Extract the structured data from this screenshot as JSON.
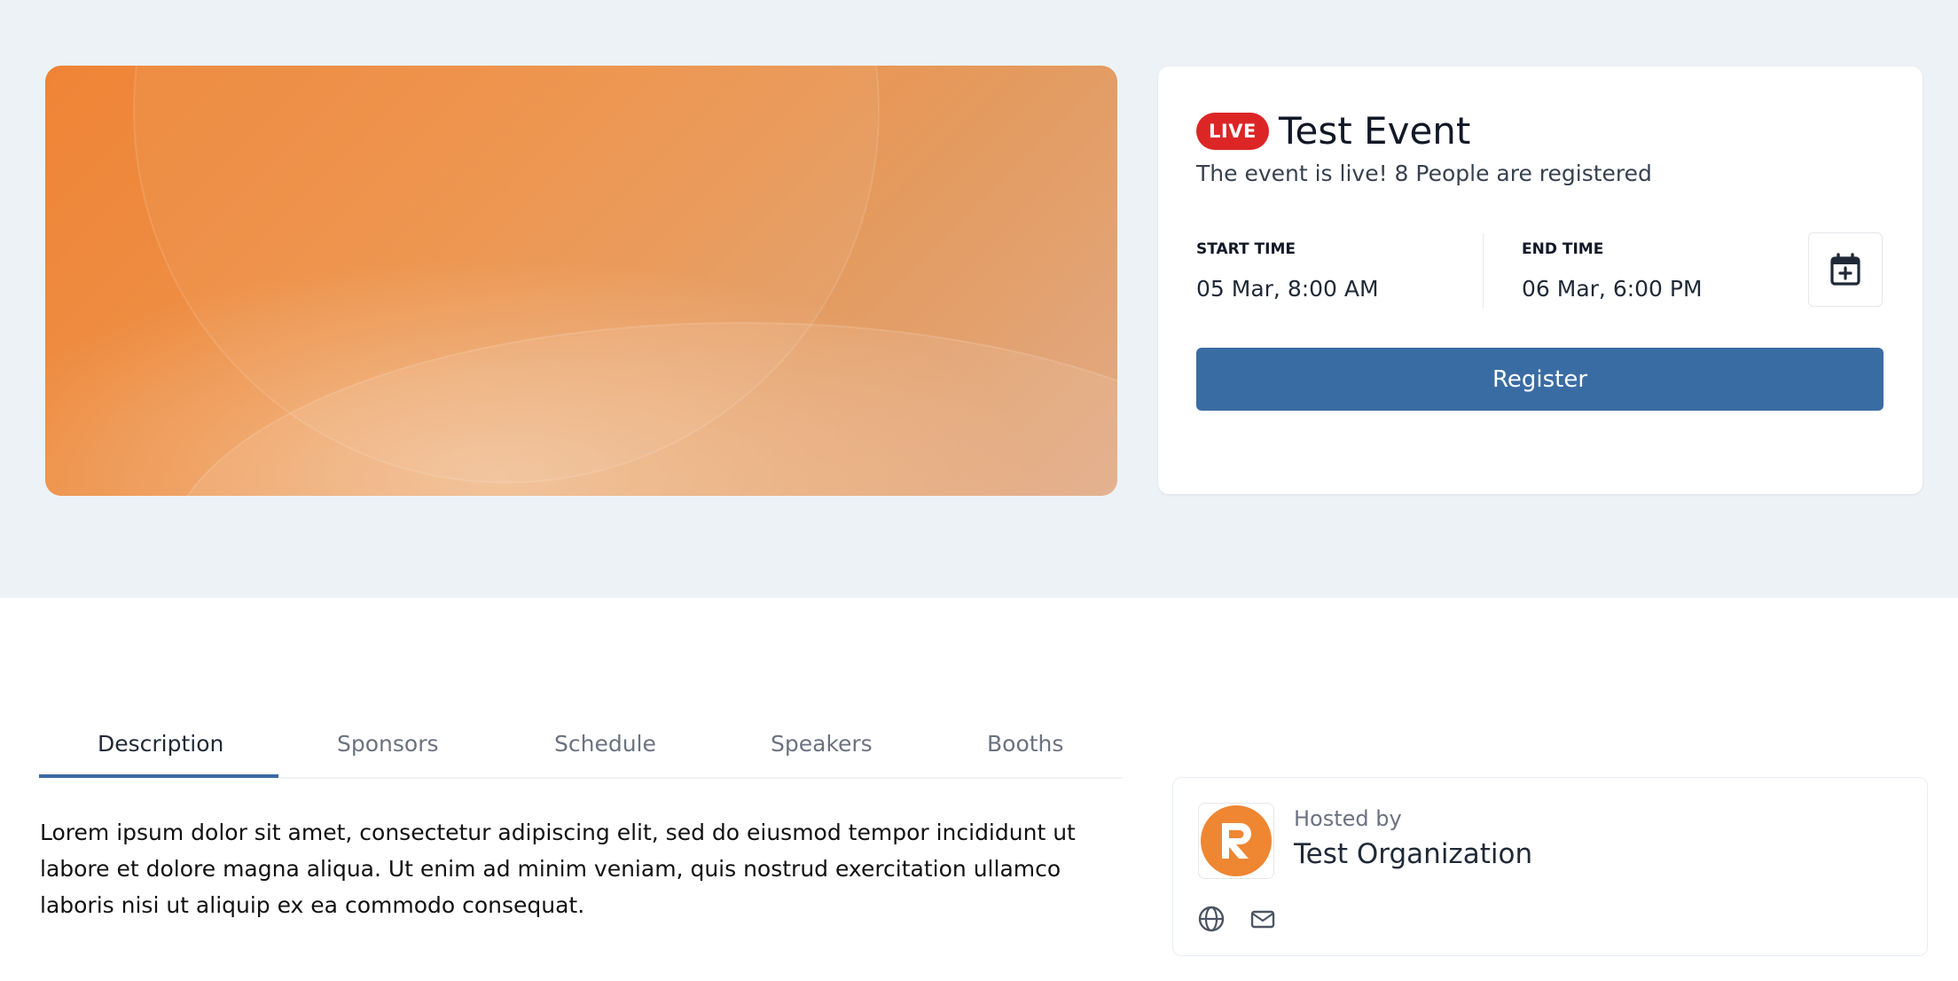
{
  "event": {
    "live_badge": "LIVE",
    "title": "Test Event",
    "status_text": "The event is live! 8 People are registered",
    "start_label": "START TIME",
    "start_value": "05 Mar, 8:00 AM",
    "end_label": "END TIME",
    "end_value": "06 Mar, 6:00 PM",
    "register_label": "Register",
    "calendar_icon": "calendar-plus-icon"
  },
  "tabs": [
    {
      "label": "Description",
      "active": true
    },
    {
      "label": "Sponsors",
      "active": false
    },
    {
      "label": "Schedule",
      "active": false
    },
    {
      "label": "Speakers",
      "active": false
    },
    {
      "label": "Booths",
      "active": false
    }
  ],
  "description": "Lorem ipsum dolor sit amet, consectetur adipiscing elit, sed do eiusmod tempor incididunt ut labore et dolore magna aliqua. Ut enim ad minim veniam, quis nostrud exercitation ullamco laboris nisi ut aliquip ex ea commodo consequat.",
  "host": {
    "hosted_by_label": "Hosted by",
    "name": "Test Organization",
    "logo_icon": "organization-logo-icon",
    "links": [
      "globe-icon",
      "mail-icon"
    ]
  },
  "colors": {
    "hero_background": "#edf2f6",
    "banner_orange": "#ef8436",
    "live_red": "#dc2626",
    "primary_blue": "#3a6ca4",
    "logo_orange": "#ef8632"
  }
}
